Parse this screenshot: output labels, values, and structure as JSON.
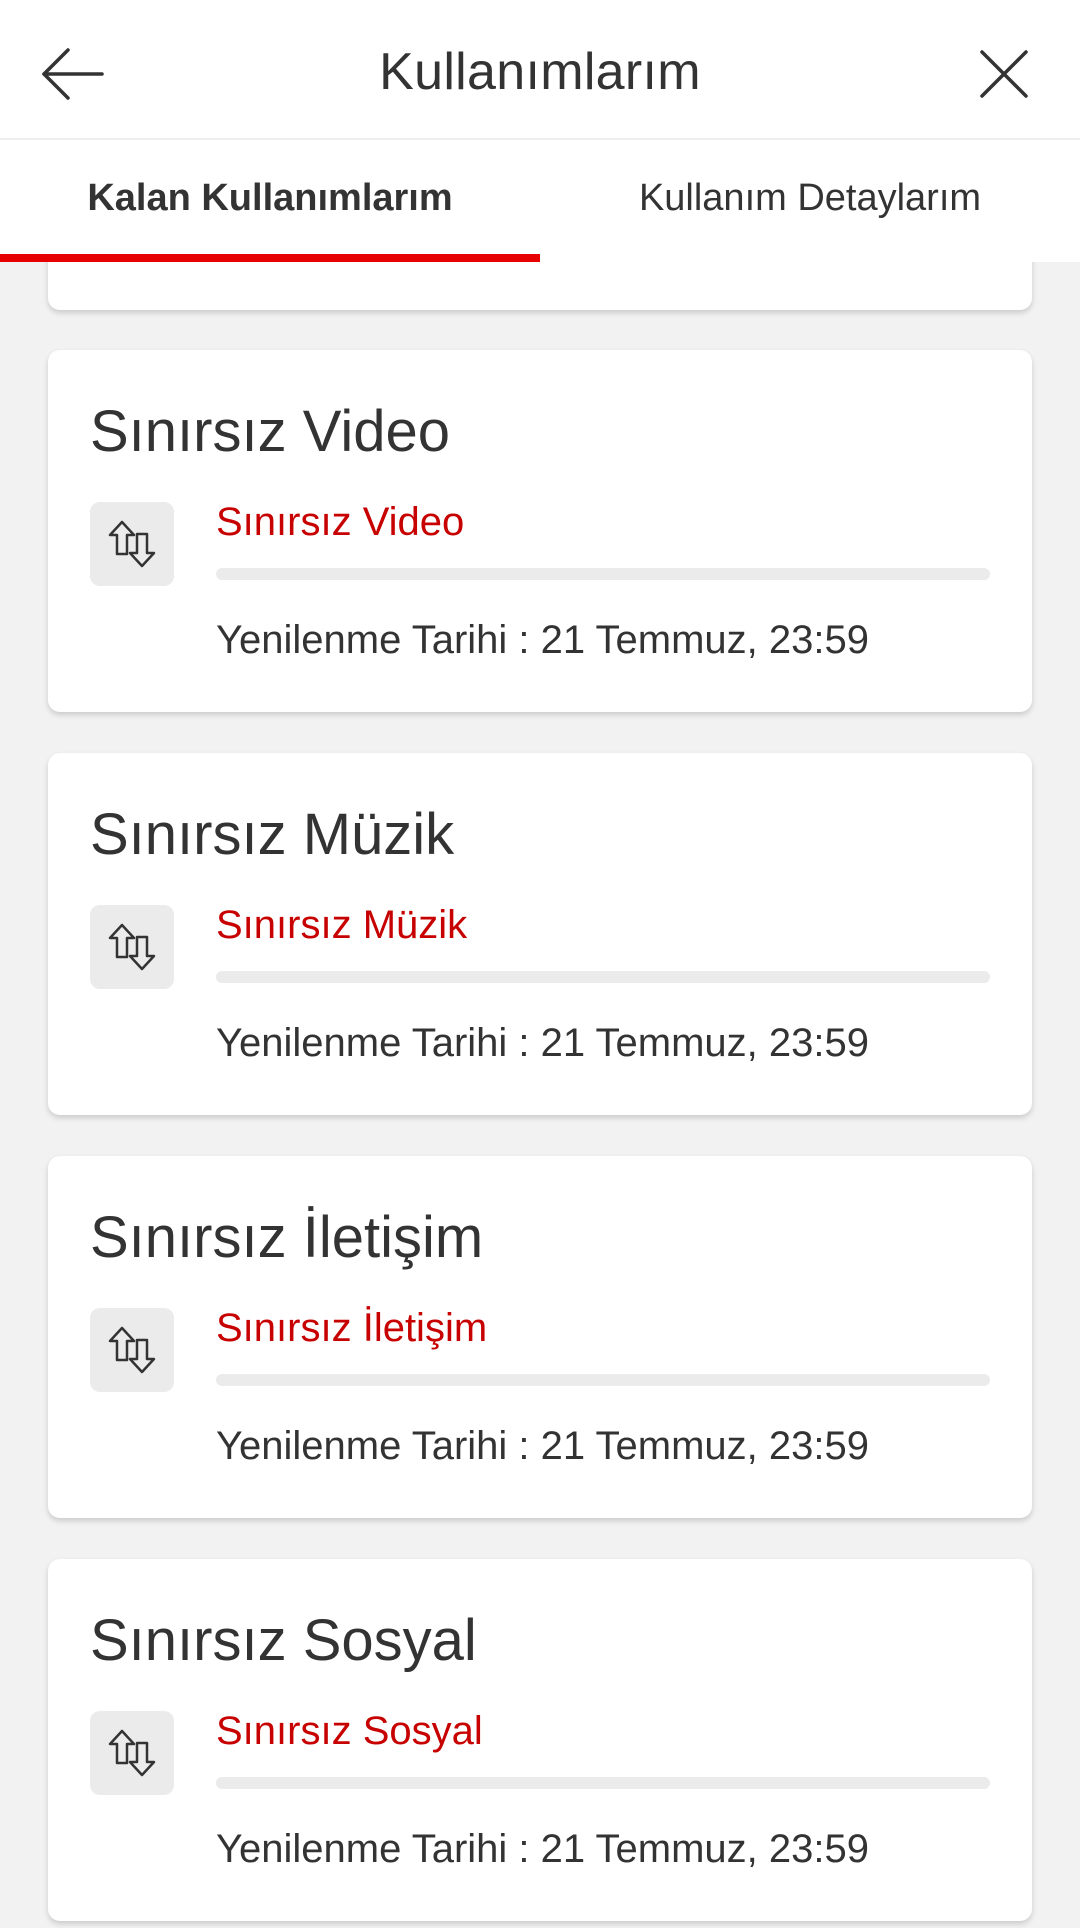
{
  "header": {
    "title": "Kullanımlarım",
    "back_icon": "arrow-left-icon",
    "close_icon": "close-icon"
  },
  "tabs": [
    {
      "label": "Kalan Kullanımlarım",
      "active": true
    },
    {
      "label": "Kullanım Detaylarım",
      "active": false
    }
  ],
  "colors": {
    "accent": "#e60000",
    "usage_name": "#c70000",
    "background": "#f2f2f2"
  },
  "usages": [
    {
      "title": "Sınırsız Video",
      "name": "Sınırsız Video",
      "icon": "data-transfer-icon",
      "usage_fraction": 0,
      "renewal": "Yenilenme Tarihi : 21 Temmuz, 23:59"
    },
    {
      "title": "Sınırsız Müzik",
      "name": "Sınırsız Müzik",
      "icon": "data-transfer-icon",
      "usage_fraction": 0,
      "renewal": "Yenilenme Tarihi : 21 Temmuz, 23:59"
    },
    {
      "title": "Sınırsız İletişim",
      "name": "Sınırsız İletişim",
      "icon": "data-transfer-icon",
      "usage_fraction": 0,
      "renewal": "Yenilenme Tarihi : 21 Temmuz, 23:59"
    },
    {
      "title": "Sınırsız Sosyal",
      "name": "Sınırsız Sosyal",
      "icon": "data-transfer-icon",
      "usage_fraction": 0,
      "renewal": "Yenilenme Tarihi : 21 Temmuz, 23:59"
    }
  ]
}
